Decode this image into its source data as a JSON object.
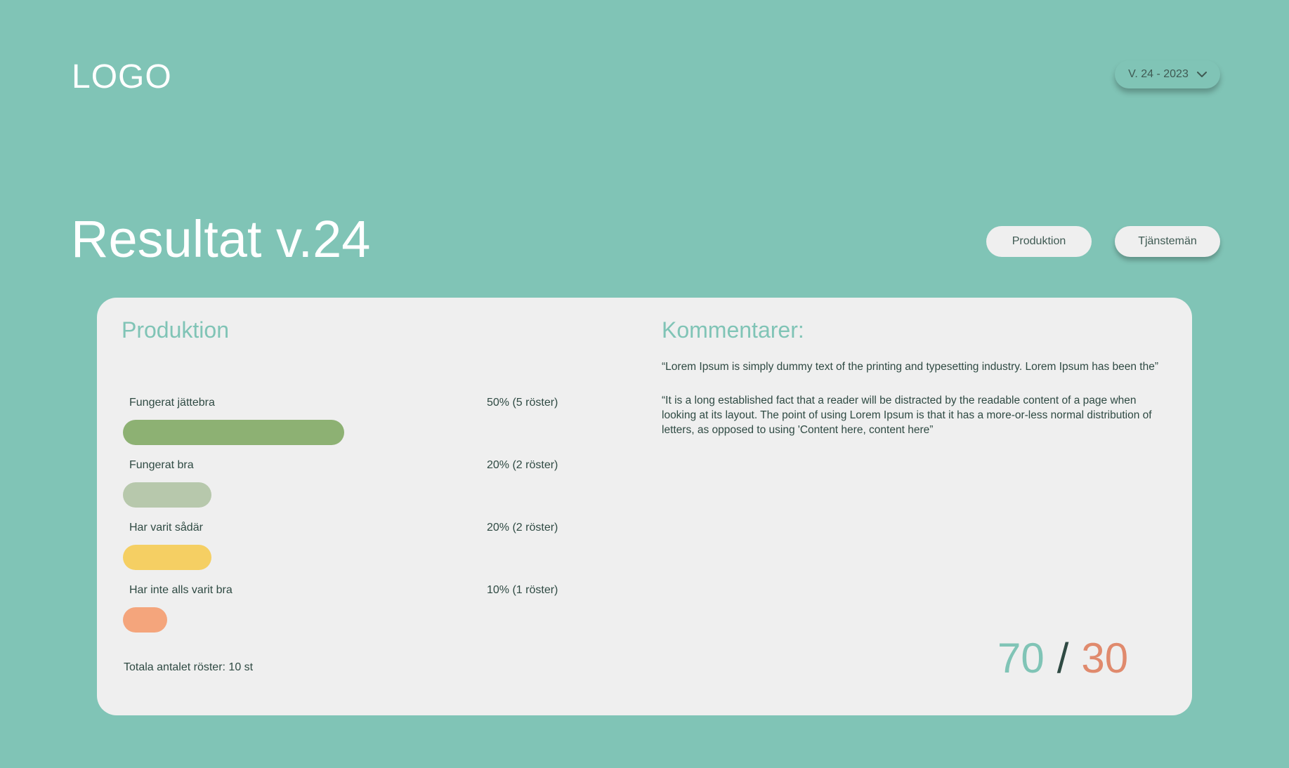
{
  "header": {
    "logo": "LOGO",
    "week_select": {
      "value": "V. 24 - 2023"
    }
  },
  "page": {
    "title": "Resultat v.24",
    "tabs": [
      {
        "label": "Produktion"
      },
      {
        "label": "Tjänstemän"
      }
    ]
  },
  "card": {
    "title": "Produktion",
    "results": [
      {
        "label": "Fungerat jättebra",
        "percent_text": "50% (5 röster)",
        "fraction": 0.5,
        "color": "#8db173"
      },
      {
        "label": "Fungerat bra",
        "percent_text": "20% (2 röster)",
        "fraction": 0.2,
        "color": "#b7c8ac"
      },
      {
        "label": "Har varit sådär",
        "percent_text": "20% (2 röster)",
        "fraction": 0.2,
        "color": "#f5cf63"
      },
      {
        "label": "Har inte alls varit bra",
        "percent_text": "10% (1 röster)",
        "fraction": 0.1,
        "color": "#f4a57c"
      }
    ],
    "total": "Totala antalet röster: 10 st",
    "ratio": {
      "left": "70",
      "separator": "/",
      "right": "30"
    }
  },
  "comments": {
    "title": "Kommentarer:",
    "items": [
      "“Lorem Ipsum is simply dummy text of the printing and typesetting industry. Lorem Ipsum has been the”",
      "“It is a long established fact that a reader will be distracted by the readable content of a page when looking at its layout. The point of using Lorem Ipsum is that it has a more-or-less normal distribution of letters, as opposed to using 'Content here, content here”"
    ]
  },
  "colors": {
    "background": "#80c4b6",
    "card": "#efefef",
    "accent": "#80c4b6",
    "ratio_right": "#e08a6d"
  }
}
